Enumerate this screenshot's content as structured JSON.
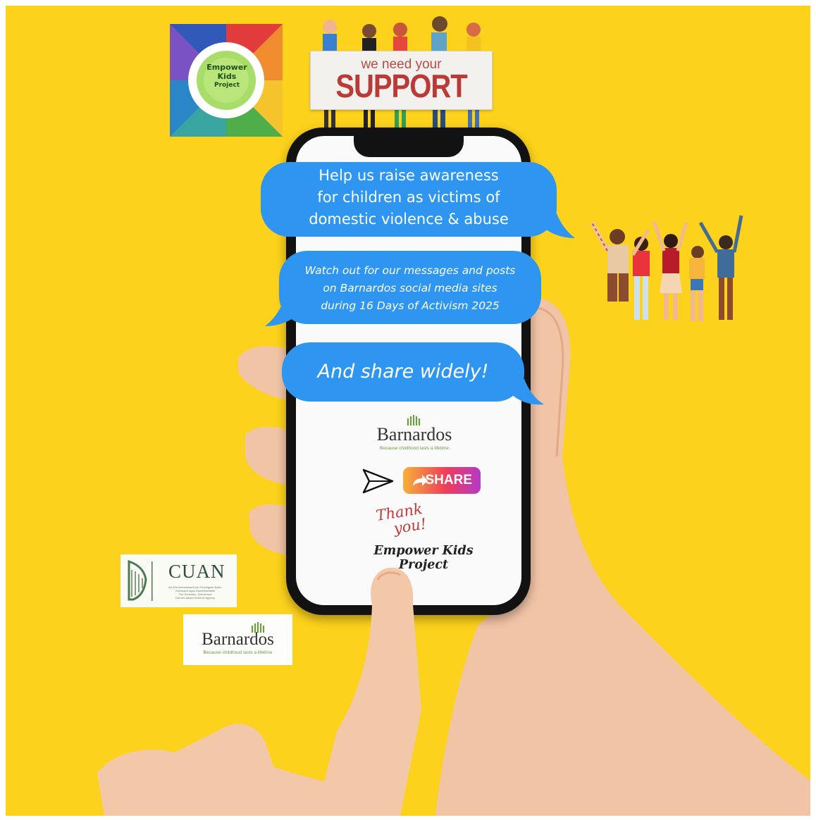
{
  "empower_logo": {
    "line1": "Empower",
    "line2": "Kids",
    "line3": "Project"
  },
  "support_sign": {
    "small": "we need your",
    "big": "SUPPORT"
  },
  "bubbles": {
    "one": {
      "line1": "Help us raise awareness",
      "line2": "for children as victims of",
      "line3": "domestic violence & abuse"
    },
    "two": {
      "line1": "Watch out for our messages and posts",
      "line2": "on Barnardos social media sites",
      "line3": "during 16 Days of Activism 2025"
    },
    "three": "And share widely!"
  },
  "barnardos": {
    "name": "Barnardos",
    "tagline": "Because childhood lasts a lifetime"
  },
  "share_button": {
    "label": "SHARE"
  },
  "thank_you": {
    "line1": "Thank",
    "line2": "you!"
  },
  "caption": "Empower Kids Project",
  "cuan": {
    "title": "CUAN",
    "sub1": "An Ghníomhaireacht um Fhoréigean Baile,",
    "sub2": "Gnéasach agus Inscebhunaithe",
    "sub3": "The Domestic, Sexual and",
    "sub4": "Gender-based Violence Agency"
  },
  "colors": {
    "background": "#fcd21c",
    "bubble": "#2e96f0",
    "phone": "#121212",
    "support": "#b93a36"
  }
}
